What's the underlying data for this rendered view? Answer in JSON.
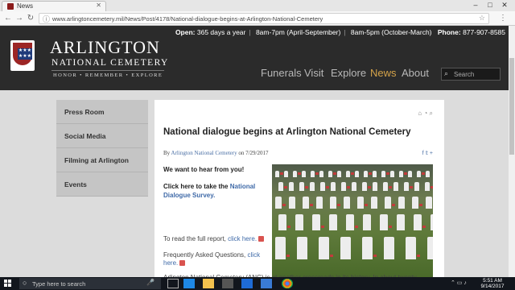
{
  "browser": {
    "tab_title": "News",
    "url": "www.arlingtoncemetery.mil/News/Post/4178/National-dialogue-begins-at-Arlington-National-Cemetery"
  },
  "header": {
    "info_bar": {
      "open_label": "Open:",
      "open_value": "365 days a year",
      "hours_summer": "8am-7pm (April-September)",
      "hours_winter": "8am-5pm (October-March)",
      "phone_label": "Phone:",
      "phone_value": "877-907-8585"
    },
    "logo": {
      "name_line1": "ARLINGTON",
      "name_line2": "NATIONAL CEMETERY",
      "tagline": "HONOR • REMEMBER • EXPLORE"
    },
    "nav": [
      {
        "label": "Funerals"
      },
      {
        "label": "Visit"
      },
      {
        "label": "Explore"
      },
      {
        "label": "News",
        "active": true
      },
      {
        "label": "About"
      }
    ],
    "search_placeholder": "Search"
  },
  "sidebar": {
    "items": [
      {
        "label": "Press Room"
      },
      {
        "label": "Social Media"
      },
      {
        "label": "Filming at Arlington"
      },
      {
        "label": "Events"
      }
    ]
  },
  "article": {
    "title": "National dialogue begins at Arlington National Cemetery",
    "by_prefix": "By",
    "author": "Arlington National Cemetery",
    "on_word": "on",
    "date": "7/29/2017",
    "lead": "We want to hear from you!",
    "cta_text": "Click here to take the",
    "cta_link": "National Dialogue Survey.",
    "fullreport_text": "To read the full report,",
    "fullreport_link": "click here.",
    "faq_text": "Frequently Asked Questions,",
    "faq_link": "click here.",
    "body_start": "Arlington National Cemetery (ANC) is at another crossroads in its history. In about twenty-"
  },
  "taskbar": {
    "search_text": "Type here to search",
    "clock_time": "5:51 AM",
    "clock_date": "9/14/2017"
  },
  "colors": {
    "header_bg": "#2b2b2b",
    "nav_active": "#d4a34a",
    "link": "#3f6aa8",
    "sidebar_bg": "#c5c5c5"
  }
}
